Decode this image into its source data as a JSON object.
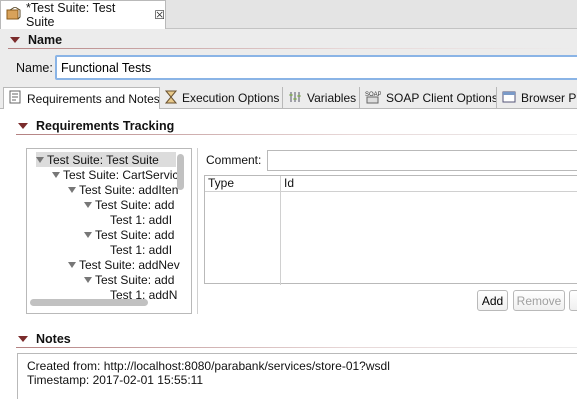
{
  "editor_tab": {
    "title": "*Test Suite: Test Suite",
    "close_glyph": "☒",
    "icon": "suite-icon"
  },
  "name_section": {
    "heading": "Name",
    "label": "Name:",
    "value": "Functional Tests"
  },
  "tabs": [
    {
      "label": "Requirements and Notes",
      "icon": "notes-icon",
      "active": true
    },
    {
      "label": "Execution Options",
      "icon": "hourglass-icon"
    },
    {
      "label": "Variables",
      "icon": "variables-icon"
    },
    {
      "label": "SOAP Client Options",
      "icon": "soap-icon"
    },
    {
      "label": "Browser Pl",
      "icon": "browser-icon"
    }
  ],
  "requirements": {
    "heading": "Requirements Tracking",
    "tree": [
      {
        "label": "Test Suite: Test Suite",
        "level": 0,
        "expanded": true,
        "selected": true
      },
      {
        "label": "Test Suite: CartServic",
        "level": 1,
        "expanded": true
      },
      {
        "label": "Test Suite: addIten",
        "level": 2,
        "expanded": true
      },
      {
        "label": "Test Suite: add",
        "level": 3,
        "expanded": true
      },
      {
        "label": "Test 1: addI",
        "level": 4,
        "expanded": false
      },
      {
        "label": "Test Suite: add",
        "level": 3,
        "expanded": true
      },
      {
        "label": "Test 1: addI",
        "level": 4,
        "expanded": false
      },
      {
        "label": "Test Suite: addNev",
        "level": 2,
        "expanded": true
      },
      {
        "label": "Test Suite: add",
        "level": 3,
        "expanded": true
      },
      {
        "label": "Test 1: addN",
        "level": 4,
        "expanded": false
      }
    ],
    "comment_label": "Comment:",
    "comment_value": "",
    "columns": [
      "Type",
      "Id"
    ],
    "add_label": "Add",
    "remove_label": "Remove"
  },
  "notes": {
    "heading": "Notes",
    "lines": [
      "Created from: http://localhost:8080/parabank/services/store-01?wsdl",
      "Timestamp: 2017-02-01 15:55:11"
    ]
  },
  "colors": {
    "accent_triangle": "#7b2c2c",
    "focus_border": "#8ab4e6"
  }
}
